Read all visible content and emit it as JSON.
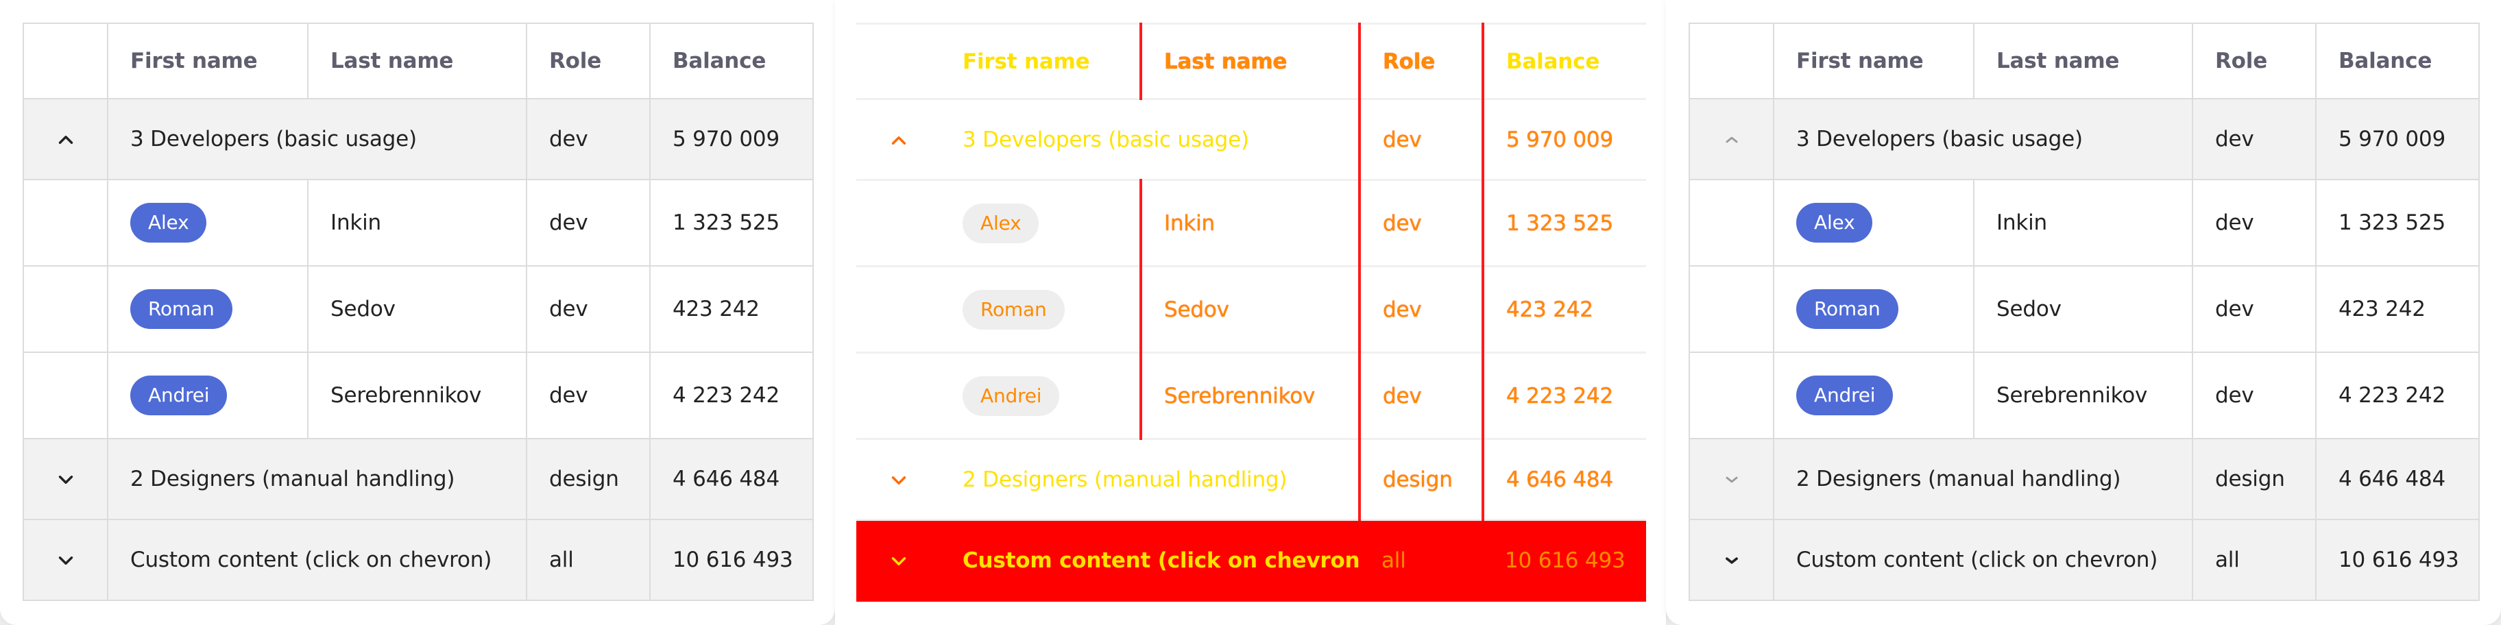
{
  "columns": [
    "First name",
    "Last name",
    "Role",
    "Balance"
  ],
  "groups": [
    {
      "label": "3 Developers (basic usage)",
      "role": "dev",
      "balance": "5 970 009",
      "state": "expanded"
    },
    {
      "label": "2 Designers (manual handling)",
      "role": "design",
      "balance": "4 646 484",
      "state": "collapsed"
    },
    {
      "label": "Custom content (click on chevron)",
      "role": "all",
      "balance": "10 616 493",
      "state": "collapsed"
    }
  ],
  "rows": [
    {
      "first": "Alex",
      "last": "Inkin",
      "role": "dev",
      "balance": "1 323 525"
    },
    {
      "first": "Roman",
      "last": "Sedov",
      "role": "dev",
      "balance": "423 242"
    },
    {
      "first": "Andrei",
      "last": "Serebrennikov",
      "role": "dev",
      "balance": "4 223 242"
    }
  ],
  "colors": {
    "chip": "#4f6bd6",
    "highlight_red": "#ff0000",
    "highlight_yellow": "#ffe200",
    "highlight_orange": "#ff8a00"
  }
}
